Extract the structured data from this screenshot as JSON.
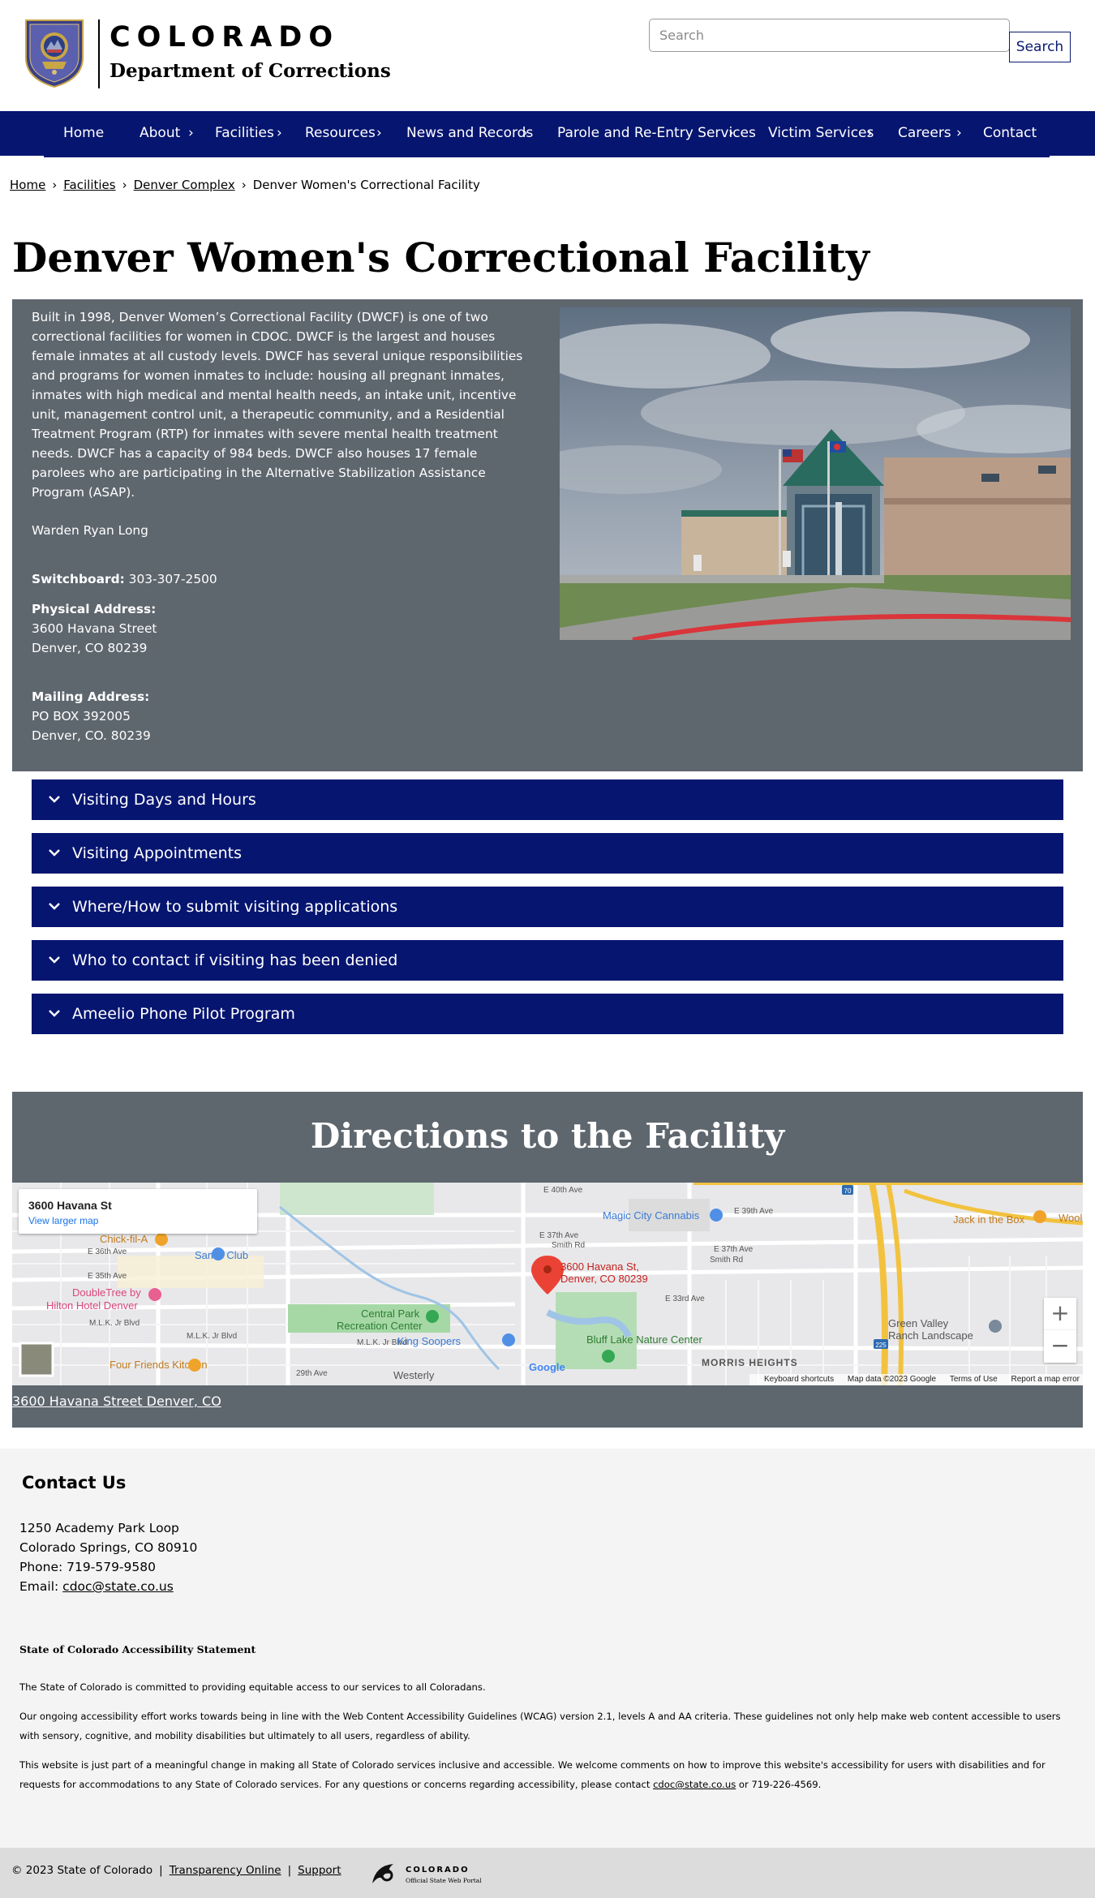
{
  "header": {
    "brand_state": "COLORADO",
    "brand_dept": "Department of Corrections",
    "search_placeholder": "Search",
    "search_button": "Search"
  },
  "nav": {
    "items": [
      {
        "label": "Home",
        "has_submenu": false
      },
      {
        "label": "About",
        "has_submenu": true
      },
      {
        "label": "Facilities",
        "has_submenu": true
      },
      {
        "label": "Resources",
        "has_submenu": true
      },
      {
        "label": "News and Records",
        "has_submenu": true
      },
      {
        "label": "Parole and Re-Entry Services",
        "has_submenu": true
      },
      {
        "label": "Victim Services",
        "has_submenu": true
      },
      {
        "label": "Careers",
        "has_submenu": true
      },
      {
        "label": "Contact",
        "has_submenu": false
      }
    ],
    "chevron": "›"
  },
  "breadcrumb": {
    "items": [
      "Home",
      "Facilities",
      "Denver Complex"
    ],
    "current": "Denver Women's Correctional Facility",
    "separator": "›"
  },
  "page_title": "Denver Women's Correctional Facility",
  "facility": {
    "intro": "Built in 1998, Denver Women’s Correctional Facility (DWCF) is one of two correctional facilities for women in CDOC.  DWCF is the largest and houses female inmates at all custody levels.  DWCF has several unique responsibilities and programs for women inmates to include:  housing all pregnant inmates, inmates with high medical and mental health needs, an intake unit, incentive unit, management control unit, a therapeutic community, and a Residential Treatment Program (RTP) for inmates with severe mental health treatment needs.  DWCF has a capacity of 984 beds.  DWCF also houses 17 female parolees who are participating in the Alternative Stabilization Assistance Program (ASAP).",
    "warden": "Warden Ryan Long",
    "switchboard_label": "Switchboard:",
    "switchboard_value": "303-307-2500",
    "physical_label": "Physical Address:",
    "physical_line1": "3600 Havana Street",
    "physical_line2": "Denver, CO 80239",
    "mailing_label": "Mailing Address:",
    "mailing_line1": "PO BOX 392005",
    "mailing_line2": "Denver, CO. 80239"
  },
  "accordions": [
    "Visiting Days and Hours",
    "Visiting Appointments",
    "Where/How to submit visiting applications",
    "Who to contact if visiting has been denied",
    "Ameelio Phone Pilot Program"
  ],
  "directions": {
    "title": "Directions to the Facility",
    "map_card_title": "3600 Havana St",
    "map_card_link": "View larger map",
    "pin_label_1": "3600 Havana St,",
    "pin_label_2": "Denver, CO 80239",
    "places": {
      "magic_city": "Magic City Cannabis",
      "jack_in_box": "Jack in the Box",
      "sams_club": "Sam's Club",
      "chick_fil_a": "Chick-fil-A",
      "doubletree_1": "DoubleTree by",
      "doubletree_2": "Hilton Hotel Denver",
      "central_park_1": "Central Park",
      "central_park_2": "Recreation Center",
      "king_soopers": "King Soopers",
      "bluff_lake": "Bluff Lake Nature Center",
      "green_valley_1": "Green Valley",
      "green_valley_2": "Ranch Landscape",
      "four_friends": "Four Friends Kitchen",
      "morris_heights": "MORRIS HEIGHTS",
      "westerly": "Westerly",
      "woolf": "Wooll",
      "google": "Google"
    },
    "streets": {
      "e40th": "E 40th Ave",
      "e39th": "E 39th Ave",
      "e37th": "E 37th Ave",
      "smith": "Smith Rd",
      "e33rd": "E 33rd Ave",
      "e36th": "E 36th Ave",
      "e35th": "E 35th Ave",
      "mlk": "M.L.K. Jr Blvd",
      "e29th": "29th Ave",
      "i70": "70",
      "i225": "225"
    },
    "footer": [
      "Keyboard shortcuts",
      "Map data ©2023 Google",
      "Terms of Use",
      "Report a map error"
    ],
    "zoom_in": "+",
    "zoom_out": "−",
    "address_link": "3600 Havana Street Denver, CO"
  },
  "contact": {
    "heading": "Contact Us",
    "line1": "1250 Academy Park Loop",
    "line2": "Colorado Springs, CO 80910",
    "line3": "Phone: 719-579-9580",
    "email_label": "Email:",
    "email": "cdoc@state.co.us"
  },
  "accessibility": {
    "heading": "State of Colorado Accessibility Statement",
    "p1": "The State of Colorado is committed to providing equitable access to our services to all Coloradans.",
    "p2": "Our ongoing accessibility effort works towards being in line with the Web Content Accessibility Guidelines (WCAG) version 2.1, levels A and AA criteria. These guidelines not only help make web content accessible to users with sensory, cognitive, and mobility disabilities but ultimately to all users, regardless of ability.",
    "p3_before": "This website is just part of a meaningful change in making all State of Colorado services inclusive and accessible. We welcome comments on how to improve this website's accessibility for users with disabilities and for requests for accommodations to any State of Colorado services. For any questions or concerns regarding accessibility, please contact ",
    "p3_link": "cdoc@state.co.us",
    "p3_after": " or 719-226-4569."
  },
  "bottom": {
    "copyright": "© 2023 State of Colorado",
    "transparency": "Transparency Online",
    "support": "Support",
    "sep": "|",
    "portal_name": "COLORADO",
    "portal_sub": "Official State Web Portal"
  },
  "colors": {
    "navy": "#061570",
    "panel_gray": "#5e666e",
    "footer_bg": "#f4f4f4",
    "bottom_bar": "#dcdcdc"
  }
}
